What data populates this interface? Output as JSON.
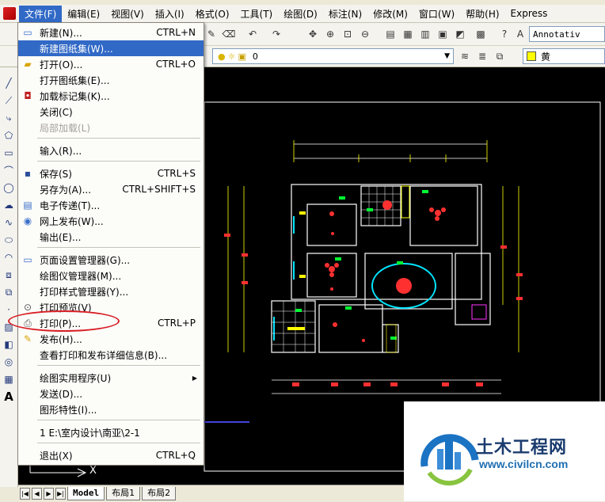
{
  "menubar": {
    "items": [
      "文件(F)",
      "编辑(E)",
      "视图(V)",
      "插入(I)",
      "格式(O)",
      "工具(T)",
      "绘图(D)",
      "标注(N)",
      "修改(M)",
      "窗口(W)",
      "帮助(H)",
      "Express"
    ]
  },
  "toolbar": {
    "annotation_scale": "Annotativ",
    "layer_value": "0",
    "color_value": "黄"
  },
  "file_menu": {
    "items": [
      {
        "label": "新建(N)...",
        "shortcut": "CTRL+N",
        "icon": "new-file-icon"
      },
      {
        "label": "新建图纸集(W)...",
        "shortcut": "",
        "icon": "",
        "highlight": true
      },
      {
        "label": "打开(O)...",
        "shortcut": "CTRL+O",
        "icon": "open-folder-icon"
      },
      {
        "label": "打开图纸集(E)...",
        "shortcut": "",
        "icon": ""
      },
      {
        "label": "加载标记集(K)...",
        "shortcut": "",
        "icon": "markup-icon"
      },
      {
        "label": "关闭(C)",
        "shortcut": "",
        "icon": ""
      },
      {
        "label": "局部加载(L)",
        "shortcut": "",
        "icon": "",
        "disabled": true
      },
      {
        "label": "输入(R)...",
        "shortcut": "",
        "icon": ""
      },
      {
        "label": "保存(S)",
        "shortcut": "CTRL+S",
        "icon": "save-icon"
      },
      {
        "label": "另存为(A)...",
        "shortcut": "CTRL+SHIFT+S",
        "icon": ""
      },
      {
        "label": "电子传递(T)...",
        "shortcut": "",
        "icon": "etransmit-icon"
      },
      {
        "label": "网上发布(W)...",
        "shortcut": "",
        "icon": "publish-web-icon"
      },
      {
        "label": "输出(E)...",
        "shortcut": "",
        "icon": ""
      },
      {
        "label": "页面设置管理器(G)...",
        "shortcut": "",
        "icon": "page-setup-icon"
      },
      {
        "label": "绘图仪管理器(M)...",
        "shortcut": "",
        "icon": ""
      },
      {
        "label": "打印样式管理器(Y)...",
        "shortcut": "",
        "icon": ""
      },
      {
        "label": "打印预览(V)",
        "shortcut": "",
        "icon": "preview-icon"
      },
      {
        "label": "打印(P)...",
        "shortcut": "CTRL+P",
        "icon": "printer-icon"
      },
      {
        "label": "发布(H)...",
        "shortcut": "",
        "icon": "publish-icon"
      },
      {
        "label": "查看打印和发布详细信息(B)...",
        "shortcut": "",
        "icon": ""
      },
      {
        "label": "绘图实用程序(U)",
        "shortcut": "",
        "icon": "",
        "submenu": true
      },
      {
        "label": "发送(D)...",
        "shortcut": "",
        "icon": ""
      },
      {
        "label": "图形特性(I)...",
        "shortcut": "",
        "icon": ""
      },
      {
        "label": "1 E:\\室内设计\\南亚\\2-1",
        "shortcut": "",
        "icon": ""
      },
      {
        "label": "退出(X)",
        "shortcut": "CTRL+Q",
        "icon": ""
      }
    ]
  },
  "layout_tabs": [
    "Model",
    "布局1",
    "布局2"
  ],
  "watermark": {
    "name_cn": "土木工程网",
    "url": "www.civilcn.com"
  },
  "colors": {
    "menu_highlight": "#3169c6",
    "annotation_circle": "#d81f26",
    "canvas_bg": "#000000"
  }
}
